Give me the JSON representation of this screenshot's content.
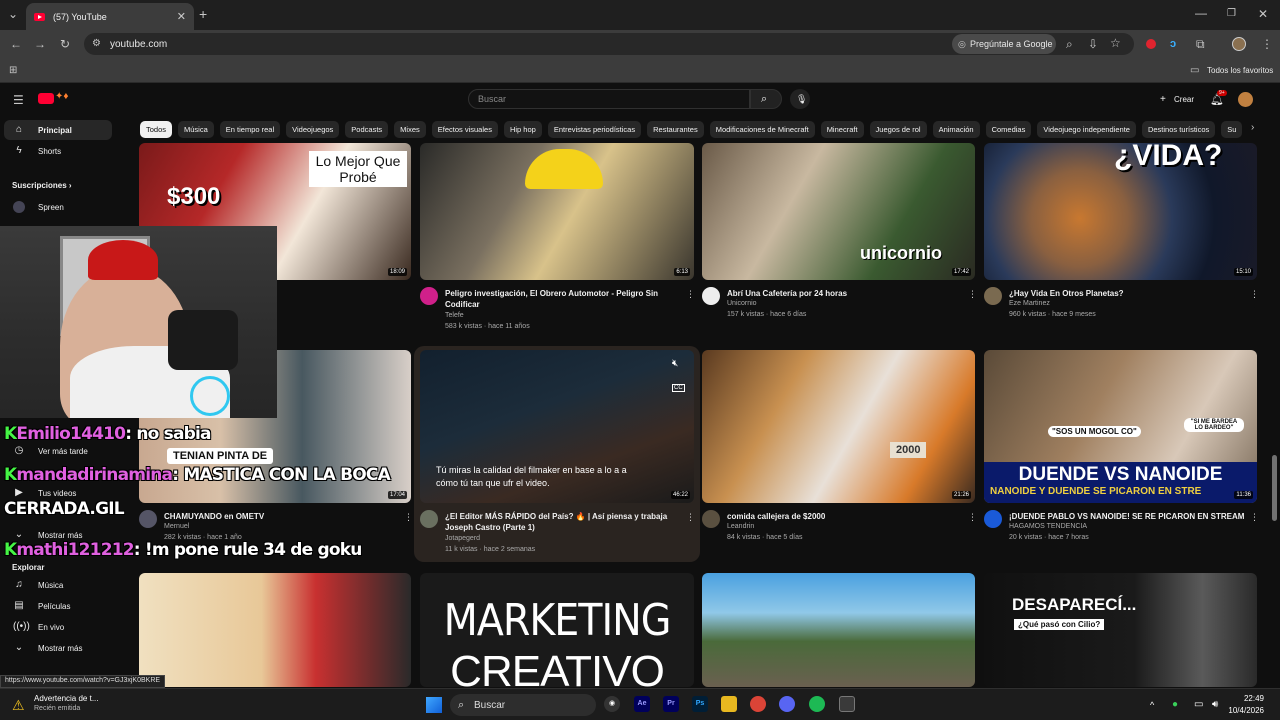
{
  "browser": {
    "tab_title": "(57) YouTube",
    "url": "youtube.com",
    "ask_google": "Pregúntale a Google",
    "bookmarks_label": "Todos los favoritos"
  },
  "youtube": {
    "search_placeholder": "Buscar",
    "create_label": "Crear",
    "notification_count": "9+"
  },
  "chips": [
    "Todos",
    "Música",
    "En tiempo real",
    "Videojuegos",
    "Podcasts",
    "Mixes",
    "Efectos visuales",
    "Hip hop",
    "Entrevistas periodísticas",
    "Restaurantes",
    "Modificaciones de Minecraft",
    "Minecraft",
    "Juegos de rol",
    "Animación",
    "Comedias",
    "Videojuego independiente",
    "Destinos turísticos",
    "Su"
  ],
  "sidebar": {
    "principal": "Principal",
    "shorts": "Shorts",
    "suscripciones": "Suscripciones",
    "sub1": "Spreen",
    "ver_mas_tarde": "Ver más tarde",
    "tus_videos": "Tus videos",
    "mostrar_mas_1": "Mostrar más",
    "explorar": "Explorar",
    "musica": "Música",
    "peliculas": "Películas",
    "en_vivo": "En vivo",
    "mostrar_mas_2": "Mostrar más"
  },
  "videos": {
    "r1c1": {
      "title": "",
      "duration": "18:09",
      "thumb_text_1": "$300",
      "thumb_text_2": "Lo Mejor Que Probé"
    },
    "r1c2": {
      "title": "Peligro investigación, El Obrero Automotor - Peligro Sin Codificar",
      "channel": "Telefe",
      "meta": "583 k vistas · hace 11 años",
      "duration": "6:13"
    },
    "r1c3": {
      "title": "Abrí Una Cafetería por 24 horas",
      "channel": "Unicornio",
      "meta": "157 k vistas · hace 6 días",
      "duration": "17:42",
      "thumb_text": "unicornio"
    },
    "r1c4": {
      "title": "¿Hay Vida En Otros Planetas?",
      "channel": "Eze Martinez",
      "meta": "960 k vistas · hace 9 meses",
      "duration": "15:10",
      "thumb_text": "¿VIDA?"
    },
    "r2c1": {
      "title": "CHAMUYANDO en OMETV",
      "channel": "Mernuel",
      "meta": "282 k vistas · hace 1 año",
      "duration": "17:04",
      "thumb_text": "TENIAN PINTA DE"
    },
    "r2c2": {
      "title": "¿El Editor MÁS RÁPIDO del País? 🔥 | Así piensa y trabaja Joseph Castro (Parte 1)",
      "channel": "Jotapegerd",
      "meta": "11 k vistas · hace 2 semanas",
      "duration": "46:22",
      "subtitle": "Tú miras la calidad del filmaker en base a lo a a cómo tú tan que ufr el video."
    },
    "r2c3": {
      "title": "comida callejera de $2000",
      "channel": "Leandrin",
      "meta": "84 k vistas · hace 5 días",
      "duration": "21:26",
      "thumb_text": "2000"
    },
    "r2c4": {
      "title": "¡DUENDE PABLO VS NANOIDE! SE RE PICARON EN STREAM",
      "channel": "HAGAMOS TENDENCIA",
      "meta": "20 k vistas · hace 7 horas",
      "duration": "11:36",
      "thumb_text_1": "DUENDE VS NANOIDE",
      "thumb_text_2": "NANOIDE Y DUENDE SE PICARON EN STRE",
      "bubble_1": "\"SOS UN MOGOL CO\"",
      "bubble_2": "\"SI ME BARDEA LO BARDEO\""
    },
    "r3c2": {
      "thumb_text_1": "MARKETING",
      "thumb_text_2": "CREATIVO"
    },
    "r3c4": {
      "thumb_text_1": "DESAPARECÍ...",
      "thumb_text_2": "¿Qué pasó con Cilio?"
    }
  },
  "overlay": {
    "chat": [
      {
        "user": "Emilio14410",
        "msg": ": no sabia"
      },
      {
        "user": "mandadirinamina",
        "msg": ": MASTICA CON LA BOCA"
      },
      {
        "user": "",
        "msg": "CERRADA.GIL"
      },
      {
        "user": "mathi121212",
        "msg": ": !m pone rule 34 de goku"
      }
    ],
    "chat_badge": "K"
  },
  "status_url": "https://www.youtube.com/watch?v=GJ3xjK0BKRE",
  "taskbar": {
    "notif_title": "Advertencia de t...",
    "notif_sub": "Recién emitida",
    "search": "Buscar",
    "time": "22:49",
    "date": "10/4/2026"
  }
}
